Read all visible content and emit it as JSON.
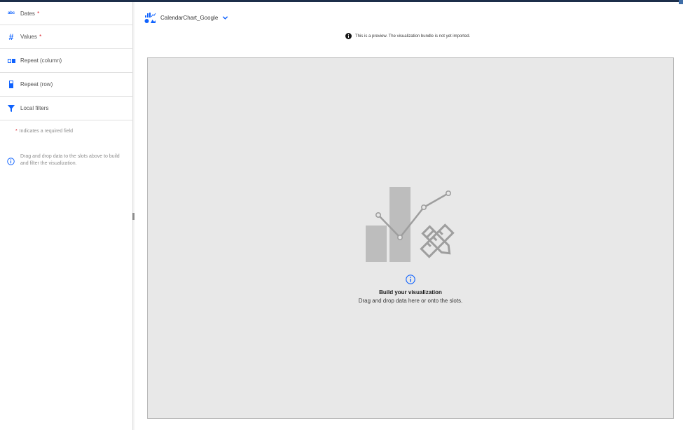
{
  "slots": [
    {
      "label": "Dates",
      "required": "*",
      "icon": "abc-text-icon"
    },
    {
      "label": "Values",
      "required": "*",
      "icon": "hash-number-icon"
    },
    {
      "label": "Repeat (column)",
      "required": "",
      "icon": "repeat-column-icon"
    },
    {
      "label": "Repeat (row)",
      "required": "",
      "icon": "repeat-row-icon"
    },
    {
      "label": "Local filters",
      "required": "",
      "icon": "filter-icon"
    }
  ],
  "abc_glyph": "abc",
  "hash_glyph": "#",
  "required_note": {
    "star": "*",
    "text": "Indicates a required field"
  },
  "hint": "Drag and drop data to the slots above to build and filter the visualization.",
  "visualization": {
    "name": "CalendarChart_Google"
  },
  "preview_note": "This is a preview. The visualization bundle is not yet imported.",
  "empty_state": {
    "title": "Build your visualization",
    "subtitle": "Drag and drop data here or onto the slots."
  },
  "colors": {
    "accent": "#0f62fe",
    "canvas": "#e8e8e8",
    "illustration": "#9e9e9e",
    "required": "#da1e28"
  }
}
